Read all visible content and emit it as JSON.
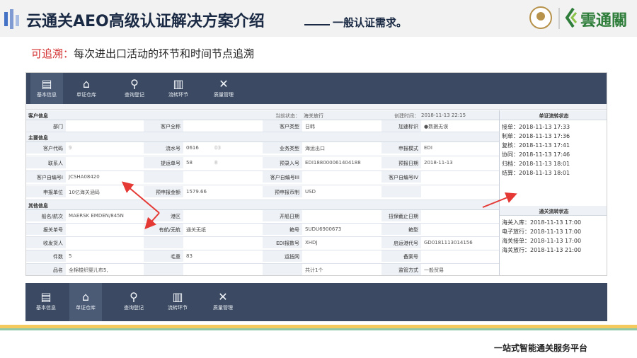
{
  "header": {
    "title": "云通关AEO高级认证解决方案介绍",
    "subtitle": "一般认证需求。",
    "logo_text": "雲通關"
  },
  "note": {
    "highlight": "可追溯：",
    "text": "每次进出口活动的环节和时间节点追溯"
  },
  "nav": [
    {
      "label": "基本信息",
      "icon": "document-icon"
    },
    {
      "label": "单证仓库",
      "icon": "warehouse-icon"
    },
    {
      "label": "查询登记",
      "icon": "search-register-icon"
    },
    {
      "label": "流转环节",
      "icon": "clipboard-icon"
    },
    {
      "label": "质量管理",
      "icon": "tools-icon"
    }
  ],
  "panel": {
    "customer_section": "客户信息",
    "status_label": "当前状态：",
    "status_value": "海关放行",
    "create_label": "创建时间：",
    "create_value": "2018-11-13 22:15",
    "customer_row": {
      "dept_label": "部门",
      "dept_value": "",
      "fullname_label": "客户全称",
      "fullname_value": "",
      "type_label": "客户类型",
      "type_value": "日韩",
      "mark_label": "加速标识",
      "mark_value": "●数据无误"
    },
    "main_section": "主要信息",
    "main_rows": [
      {
        "l1": "客户代码",
        "v1": "9",
        "l2": "流水号",
        "v2": "0616",
        "v2b": "03",
        "l3": "业务类型",
        "v3": "海运出口",
        "l4": "申报模式",
        "v4": "EDI"
      },
      {
        "l1": "联系人",
        "v1": "",
        "l2": "提运单号",
        "v2": "58",
        "v2b": "8",
        "l3": "预录入号",
        "v3": "EDI188000061404188",
        "l4": "预报日期",
        "v4": "2018-11-13"
      },
      {
        "l1": "客户自编号I",
        "v1": "JCSHA08420",
        "l2": "",
        "v2": "",
        "v2b": "",
        "l3": "客户自编号III",
        "v3": "",
        "l4": "客户自编号IV",
        "v4": ""
      },
      {
        "l1": "申报单位",
        "v1": "10亿海关涵码",
        "l2": "预申报金额",
        "v2": "1579.66",
        "v2b": "",
        "l3": "预申报币制",
        "v3": "USD",
        "l4": "",
        "v4": ""
      }
    ],
    "other_section": "其他信息",
    "other_rows": [
      {
        "l1": "船名/航次",
        "v1": "MAERSK EMDEN/845N",
        "l2": "港区",
        "v2": "",
        "l3": "开船日期",
        "v3": "",
        "l4": "扭保截止日期",
        "v4": ""
      },
      {
        "l1": "报关单号",
        "v1": "",
        "l2": "有航/无航",
        "v2": "通关无纸",
        "l3": "箱号",
        "v3": "SUDU6900673",
        "l4": "箱型",
        "v4": ""
      },
      {
        "l1": "收发货人",
        "v1": "",
        "l2": "",
        "v2": "",
        "l3": "EDI报数号",
        "v3": "XHDJ",
        "l4": "启运港代号",
        "v4": "GD0181113014156"
      },
      {
        "l1": "件数",
        "v1": "5",
        "l2": "毛重",
        "v2": "83",
        "l3": "运抵网",
        "v3": "",
        "l4": "备案号",
        "v4": ""
      },
      {
        "l1": "品名",
        "v1": "全棉梭织婴儿布5,",
        "l2": "",
        "v2": "",
        "l3": "",
        "v3": "共计1个",
        "l4": "监管方式",
        "v4": "一般贸易"
      }
    ],
    "doc_flow_title": "单证流转状态",
    "doc_flow": [
      "接单：2018-11-13 17:33",
      "制单：2018-11-13 17:36",
      "复核：2018-11-13 17:41",
      "协同：2018-11-13 17:46",
      "归档：2018-11-13 18:01",
      "结算：2018-11-13 18:01"
    ],
    "customs_flow_title": "通关流转状态",
    "customs_flow": [
      "海关入库：2018-11-13 17:00",
      "电子放行：2018-11-13 17:00",
      "海关接单：2018-11-13 17:00",
      "海关放行：2018-11-13 21:00"
    ]
  },
  "footer": {
    "text": "一站式智能通关服务平台"
  },
  "colors": {
    "nav_bg": "#3b4a62",
    "red": "#d32f2f",
    "arrow": "#e53935",
    "brand_green": "#2e7d3a",
    "brand_gold": "#b7924a"
  }
}
